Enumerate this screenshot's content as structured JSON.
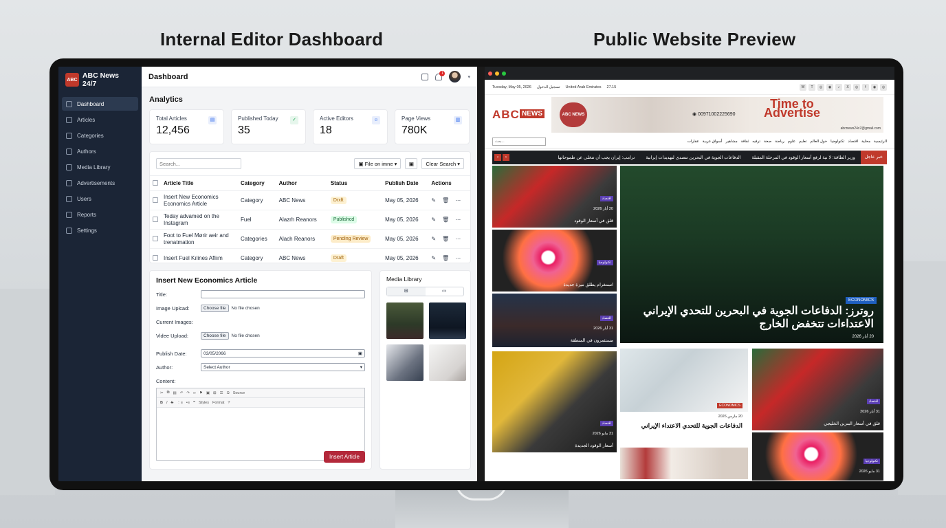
{
  "headings": {
    "left": "Internal Editor Dashboard",
    "right": "Public Website Preview"
  },
  "sidebar": {
    "brand_logo": "ABC",
    "brand": "ABC News 24/7",
    "items": [
      {
        "label": "Dashboard",
        "icon": "home-icon"
      },
      {
        "label": "Articles",
        "icon": "document-icon"
      },
      {
        "label": "Categories",
        "icon": "folder-icon"
      },
      {
        "label": "Authors",
        "icon": "user-icon"
      },
      {
        "label": "Media Library",
        "icon": "image-icon"
      },
      {
        "label": "Advertisements",
        "icon": "megaphone-icon"
      },
      {
        "label": "Users",
        "icon": "users-icon"
      },
      {
        "label": "Reports",
        "icon": "chart-icon"
      },
      {
        "label": "Settings",
        "icon": "gear-icon"
      }
    ]
  },
  "topbar": {
    "title": "Dashboard",
    "notifications": "1"
  },
  "analytics": {
    "title": "Analytics",
    "cards": [
      {
        "label": "Total Articles",
        "value": "12,456"
      },
      {
        "label": "Published Today",
        "value": "35"
      },
      {
        "label": "Active Editors",
        "value": "18"
      },
      {
        "label": "Page Views",
        "value": "780K"
      }
    ]
  },
  "table": {
    "search_placeholder": "Search...",
    "filter_label": "File on imne",
    "clear_label": "Clear Search",
    "headers": [
      "Article Title",
      "Category",
      "Author",
      "Status",
      "Publish Date",
      "Actions"
    ],
    "rows": [
      {
        "title": "Insert New Economics Economics Article",
        "category": "Category",
        "author": "ABC News",
        "status": "Drxft",
        "date": "May 05, 2026"
      },
      {
        "title": "Teday advamed on the Instagram",
        "category": "Fuel",
        "author": "Alazrh Reanors",
        "status": "Publishcd",
        "date": "May 05, 2026"
      },
      {
        "title": "Foot to Fuel Mørir aeir and trenatmation",
        "category": "Categories",
        "author": "Alach Reanors",
        "status": "Pending Review",
        "date": "May 05, 2026"
      },
      {
        "title": "Insert Fuel Kılines Afliım",
        "category": "Category",
        "author": "ABC News",
        "status": "Draft",
        "date": "May 05, 2026"
      }
    ]
  },
  "insert_form": {
    "title": "Insert New Economics Article",
    "title_label": "Title:",
    "image_label": "Image Uplcad:",
    "current_images_label": "Current Images:",
    "video_label": "Videe Upload:",
    "choose_file": "Choose file",
    "no_file": "No file chosen",
    "publish_label": "Publish Date:",
    "publish_value": "03/05/2066",
    "author_label": "Author:",
    "author_value": "Select Author",
    "content_label": "Content:",
    "toolbar_row1": [
      "Source"
    ],
    "toolbar_row2": [
      "B",
      "I",
      "S",
      "Styles",
      "Format",
      "?"
    ],
    "submit": "Insert Article"
  },
  "media_library": {
    "title": "Media Library"
  },
  "site": {
    "date_line": "Tuesday, May 05, 2026",
    "login": "تسجيل الدخول",
    "location": "United Arab Emirates",
    "temp": "27.15",
    "social": [
      "W",
      "T",
      "◎",
      "◉",
      "♪",
      "X",
      "◎",
      "f",
      "◉",
      "◎"
    ],
    "logo_abc": "ABC",
    "logo_news": "NEWS",
    "ad_seal": "ABC NEWS",
    "ad_phone": "00971002225690",
    "ad_time": "Time to",
    "ad_advertise": "Advertise",
    "ad_email": "abcnews24x7@gmail.com",
    "search_placeholder": "بحث...",
    "menu": [
      "الرئيسية",
      "محلية",
      "اقتصاد",
      "تكنولوجيا",
      "حول العالم",
      "تعليم",
      "علوم",
      "رياضة",
      "صحة",
      "ترفيه",
      "ثقافة",
      "مشاهير",
      "أسواق عربية",
      "عقارات"
    ],
    "ticker_label": "خبر عاجل",
    "ticker_items": [
      "وزير الطاقة: لا نية لرفع أسعار الوقود في المرحلة المقبلة",
      "الدفاعات الجوية في البحرين تتصدى لتهديدات إيرانية",
      "ترامب: إيران يجب أن تتخلى عن طموحاتها"
    ],
    "left_cards": [
      {
        "tag": "اقتصاد",
        "date": "20 أيار 2026",
        "title": "قلق في أسعار الوقود"
      },
      {
        "tag": "تكنولوجيا",
        "date": "",
        "title": "انستغرام يطلق ميزة جديدة"
      },
      {
        "tag": "اقتصاد",
        "date": "31 أيار 2026",
        "title": "مستثمرون في المنطقة"
      },
      {
        "tag": "اقتصاد",
        "date": "31 مايو 2026",
        "title": "أسعار الوقود الجديدة"
      }
    ],
    "featured": {
      "tag": "ECONOMICS",
      "title": "روترز: الدفاعات الجوية في البحرين للتحدي الإيراني الاعتداءات تتخفض الخارج",
      "date": "20 أيار 2026"
    },
    "mid_card": {
      "tag": "ECONOMICS",
      "date": "20 مارس 2026",
      "title": "الدفاعات الجوية للتحدي الاعتداء الإيراني"
    },
    "right_cards": [
      {
        "tag": "اقتصاد",
        "date": "31 أيار 2026",
        "title": "قلق في أسعار البنزين الخليجي"
      },
      {
        "tag": "تكنولوجيا",
        "date": "31 مايو 2026",
        "title": ""
      }
    ]
  }
}
